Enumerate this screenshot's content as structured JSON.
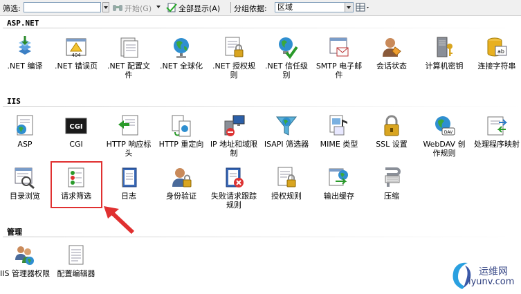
{
  "toolbar": {
    "filter_label": "筛选:",
    "filter_value": "",
    "start_label": "开始(G)",
    "show_all_label": "全部显示(A)",
    "group_by_label": "分组依据:",
    "group_by_value": "区域"
  },
  "groups": {
    "aspnet": {
      "title": "ASP.NET",
      "items": [
        {
          "label": ".NET 编译",
          "icon": "net-compile-icon"
        },
        {
          "label": ".NET 错误页",
          "icon": "net-error-pages-icon"
        },
        {
          "label": ".NET 配置文件",
          "icon": "net-profile-icon"
        },
        {
          "label": ".NET 全球化",
          "icon": "net-globalization-icon"
        },
        {
          "label": ".NET 授权规则",
          "icon": "net-authorization-icon"
        },
        {
          "label": ".NET 信任级别",
          "icon": "net-trust-levels-icon"
        },
        {
          "label": "SMTP 电子邮件",
          "icon": "smtp-email-icon"
        },
        {
          "label": "会话状态",
          "icon": "session-state-icon"
        },
        {
          "label": "计算机密钥",
          "icon": "machine-key-icon"
        },
        {
          "label": "连接字符串",
          "icon": "connection-strings-icon"
        }
      ]
    },
    "iis": {
      "title": "IIS",
      "items": [
        {
          "label": "ASP",
          "icon": "asp-icon"
        },
        {
          "label": "CGI",
          "icon": "cgi-icon"
        },
        {
          "label": "HTTP 响应标头",
          "icon": "http-response-headers-icon"
        },
        {
          "label": "HTTP 重定向",
          "icon": "http-redirect-icon"
        },
        {
          "label": "IP 地址和域限制",
          "icon": "ip-domain-restrictions-icon"
        },
        {
          "label": "ISAPI 筛选器",
          "icon": "isapi-filters-icon"
        },
        {
          "label": "MIME 类型",
          "icon": "mime-types-icon"
        },
        {
          "label": "SSL 设置",
          "icon": "ssl-settings-icon"
        },
        {
          "label": "WebDAV 创作规则",
          "icon": "webdav-authoring-icon"
        },
        {
          "label": "处理程序映射",
          "icon": "handler-mappings-icon"
        },
        {
          "label": "目录浏览",
          "icon": "directory-browsing-icon"
        },
        {
          "label": "请求筛选",
          "icon": "request-filtering-icon"
        },
        {
          "label": "日志",
          "icon": "logging-icon"
        },
        {
          "label": "身份验证",
          "icon": "authentication-icon"
        },
        {
          "label": "失败请求跟踪规则",
          "icon": "failed-request-tracing-icon"
        },
        {
          "label": "授权规则",
          "icon": "authorization-rules-icon"
        },
        {
          "label": "输出缓存",
          "icon": "output-caching-icon"
        },
        {
          "label": "压缩",
          "icon": "compression-icon"
        }
      ]
    },
    "management": {
      "title": "管理",
      "items": [
        {
          "label": "IIS 管理器权限",
          "icon": "iis-manager-permissions-icon"
        },
        {
          "label": "配置编辑器",
          "icon": "configuration-editor-icon"
        }
      ]
    }
  },
  "watermark": {
    "cn": "运维网",
    "en": "iyunv.com"
  }
}
